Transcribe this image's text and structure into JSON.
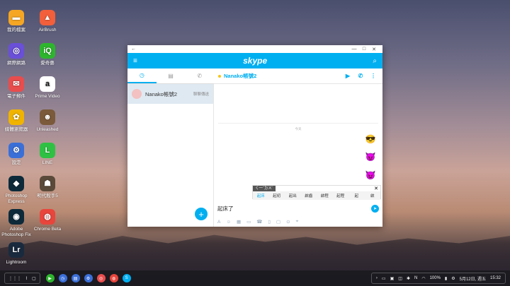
{
  "desktop": {
    "icons_left": [
      {
        "label": "我的檔案",
        "color": "#f5a623",
        "glyph": "▬",
        "icon": "folder-icon"
      },
      {
        "label": "網際網路",
        "color": "#6a4fd8",
        "glyph": "◎",
        "icon": "globe-icon"
      },
      {
        "label": "電子郵件",
        "color": "#e84d4d",
        "glyph": "✉",
        "icon": "mail-icon"
      },
      {
        "label": "媒體瀏覽器",
        "color": "#f0b400",
        "glyph": "✿",
        "icon": "media-icon"
      },
      {
        "label": "設定",
        "color": "#3a6fd8",
        "glyph": "⚙",
        "icon": "gear-icon"
      },
      {
        "label": "Photoshop Express",
        "color": "#0d2a3a",
        "glyph": "◆",
        "icon": "photoshop-express-icon"
      },
      {
        "label": "Adobe Photoshop Fix",
        "color": "#0d2a3a",
        "glyph": "◉",
        "icon": "photoshop-fix-icon"
      },
      {
        "label": "Lightroom",
        "color": "#1a2a3e",
        "glyph": "Lr",
        "icon": "lightroom-icon"
      }
    ],
    "icons_right": [
      {
        "label": "AirBrush",
        "color": "#f25f3a",
        "glyph": "▲",
        "icon": "airbrush-icon"
      },
      {
        "label": "愛奇藝",
        "color": "#2db52d",
        "glyph": "iQ",
        "icon": "iqiyi-icon"
      },
      {
        "label": "Prime Video",
        "color": "#ffffff",
        "glyph": "a",
        "icon": "prime-video-icon"
      },
      {
        "label": "Unleashed",
        "color": "#7a5a3a",
        "glyph": "☻",
        "icon": "unleashed-icon"
      },
      {
        "label": "LINE",
        "color": "#2fc144",
        "glyph": "L",
        "icon": "line-icon"
      },
      {
        "label": "明代殺手5",
        "color": "#5a4a3a",
        "glyph": "☗",
        "icon": "game-icon"
      },
      {
        "label": "Chrome Beta",
        "color": "#e8453c",
        "glyph": "◍",
        "icon": "chrome-beta-icon"
      }
    ]
  },
  "skype": {
    "titlebar": {
      "back": "←",
      "minimize": "—",
      "maximize": "□",
      "close": "✕"
    },
    "header": {
      "menu": "≡",
      "logo": "skype",
      "search": "⌕"
    },
    "tabs": [
      {
        "icon": "clock-icon",
        "glyph": "◷"
      },
      {
        "icon": "contacts-icon",
        "glyph": "▤"
      },
      {
        "icon": "phone-icon",
        "glyph": "✆"
      }
    ],
    "conversation": {
      "name": "Nanako帳號2",
      "status": "聊聊傳送"
    },
    "chat": {
      "title": "Nanako帳號2",
      "video": "▶",
      "call": "✆",
      "more": "⋮",
      "divider": "今天",
      "emojis": [
        "😎",
        "😈",
        "😈"
      ]
    },
    "ime": {
      "composition": "ㄑ一ˇㄉㄨˋ",
      "close": "✕",
      "candidates": [
        "起床",
        "起初",
        "起出",
        "啟齒",
        "啟程",
        "起程",
        "起",
        "啟"
      ]
    },
    "input": {
      "text": "起床了",
      "send": "➤"
    },
    "toolbar": [
      "A",
      "☺",
      "▦",
      "▭",
      "☎",
      "▯",
      "▢",
      "⊙",
      "⌖"
    ]
  },
  "taskbar": {
    "left": [
      "⋮⋮⋮",
      "⌇",
      "▢"
    ],
    "apps": [
      {
        "glyph": "▶",
        "color": "#2db52d",
        "icon": "play-store-icon"
      },
      {
        "glyph": "◷",
        "color": "#3a6fd8",
        "icon": "clock-icon"
      },
      {
        "glyph": "▤",
        "color": "#3a6fd8",
        "icon": "calendar-icon"
      },
      {
        "glyph": "⚙",
        "color": "#3a6fd8",
        "icon": "gear-icon"
      },
      {
        "glyph": "◎",
        "color": "#e84d4d",
        "icon": "camera-icon"
      },
      {
        "glyph": "◍",
        "color": "#e8453c",
        "icon": "chrome-icon"
      },
      {
        "glyph": "S",
        "color": "#00aff0",
        "icon": "skype-icon"
      }
    ],
    "tray": {
      "battery": "100%",
      "date": "5月12日, 週五",
      "time": "15:32"
    }
  }
}
